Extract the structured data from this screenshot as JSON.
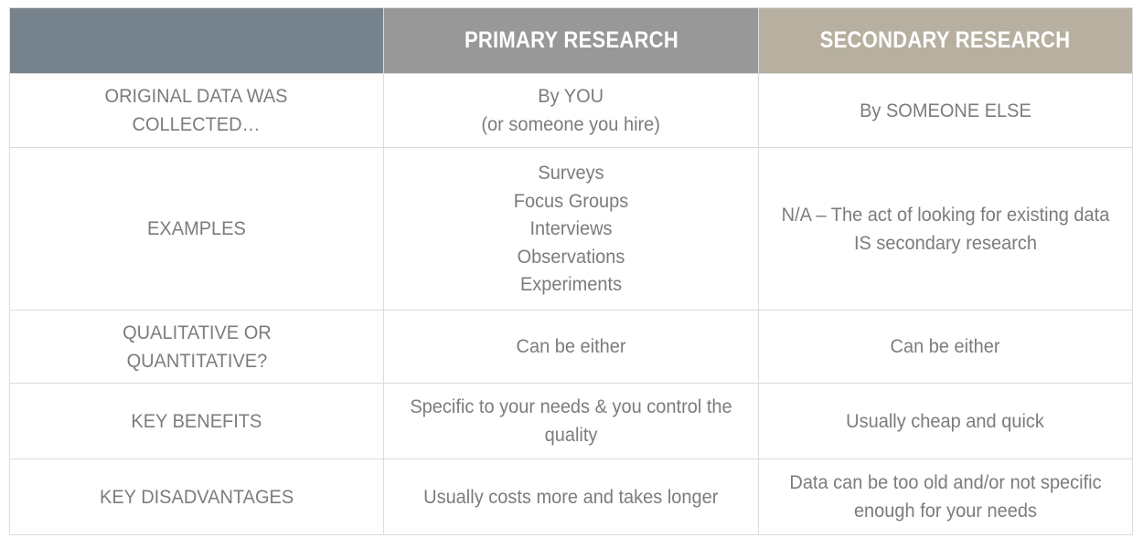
{
  "table": {
    "columns": [
      {
        "key": "label",
        "header": ""
      },
      {
        "key": "primary",
        "header": "PRIMARY RESEARCH"
      },
      {
        "key": "secondary",
        "header": "SECONDARY RESEARCH"
      }
    ],
    "header_colors": {
      "label_bg": "#76828c",
      "primary_bg": "#989898",
      "secondary_bg": "#b7b0a0",
      "header_text": "#ffffff"
    },
    "body_colors": {
      "text": "#7c7c7c",
      "cell_bg": "#ffffff",
      "border": "#dcdcdc"
    },
    "rows": [
      {
        "label": "ORIGINAL DATA WAS\nCOLLECTED…",
        "primary": "By YOU\n(or someone you hire)",
        "secondary": "By SOMEONE ELSE"
      },
      {
        "label": "EXAMPLES",
        "primary": "Surveys\nFocus Groups\nInterviews\nObservations\nExperiments",
        "secondary": "N/A – The act of looking for existing data IS secondary research"
      },
      {
        "label": "QUALITATIVE OR\nQUANTITATIVE?",
        "primary": "Can be either",
        "secondary": "Can be either"
      },
      {
        "label": "KEY BENEFITS",
        "primary": "Specific to your needs & you control the quality",
        "secondary": "Usually cheap and quick"
      },
      {
        "label": "KEY DISADVANTAGES",
        "primary": "Usually costs more and takes longer",
        "secondary": "Data can be too old and/or not specific enough for your needs"
      }
    ]
  }
}
